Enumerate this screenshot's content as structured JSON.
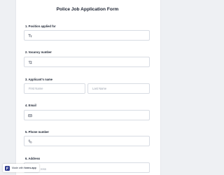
{
  "form": {
    "title": "Police Job Application Form"
  },
  "questions": [
    {
      "label": "1. Position applied for",
      "icon": "text-type-icon"
    },
    {
      "label": "2. Vacancy number",
      "icon": "number-icon"
    },
    {
      "label": "3. Applicant's name",
      "first_placeholder": "First Name",
      "last_placeholder": "Last Name"
    },
    {
      "label": "4. Email",
      "icon": "email-icon"
    },
    {
      "label": "5. Phone number",
      "icon": "phone-icon"
    },
    {
      "label": "6. Address",
      "cut_placeholder": "ress"
    }
  ],
  "badge": {
    "made_with": "Made with",
    "brand": "forms.app"
  },
  "colors": {
    "background": "#eef0f3",
    "card": "#ffffff",
    "border": "#d8dce3",
    "brand": "#2d3a8c"
  }
}
